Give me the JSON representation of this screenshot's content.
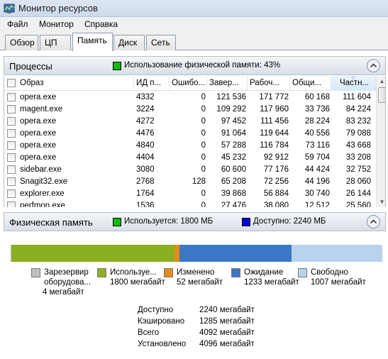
{
  "window": {
    "title": "Монитор ресурсов",
    "icon": "resource-monitor-icon"
  },
  "menu": [
    "Файл",
    "Монитор",
    "Справка"
  ],
  "tabs": [
    {
      "label": "Обзор",
      "active": false
    },
    {
      "label": "ЦП",
      "active": false
    },
    {
      "label": "Память",
      "active": true
    },
    {
      "label": "Диск",
      "active": false
    },
    {
      "label": "Сеть",
      "active": false
    }
  ],
  "processes": {
    "title": "Процессы",
    "indicator": "Использование физической памяти: 43%",
    "indicator_color": "#00c000",
    "columns": [
      "Образ",
      "ИД п...",
      "Ошибо...",
      "Завер...",
      "Рабоч...",
      "Общи...",
      "Частн..."
    ],
    "sorted_column": "Частн...",
    "rows": [
      [
        "opera.exe",
        "4332",
        "0",
        "121 536",
        "171 772",
        "60 168",
        "111 604"
      ],
      [
        "magent.exe",
        "3224",
        "0",
        "109 292",
        "117 960",
        "33 736",
        "84 224"
      ],
      [
        "opera.exe",
        "4272",
        "0",
        "97 452",
        "111 456",
        "28 224",
        "83 232"
      ],
      [
        "opera.exe",
        "4476",
        "0",
        "91 064",
        "119 644",
        "40 556",
        "79 088"
      ],
      [
        "opera.exe",
        "4840",
        "0",
        "57 288",
        "116 784",
        "73 116",
        "43 668"
      ],
      [
        "opera.exe",
        "4404",
        "0",
        "45 232",
        "92 912",
        "59 704",
        "33 208"
      ],
      [
        "sidebar.exe",
        "3080",
        "0",
        "60 600",
        "77 176",
        "44 424",
        "32 752"
      ],
      [
        "Snagit32.exe",
        "2768",
        "128",
        "65 208",
        "72 256",
        "44 196",
        "28 060"
      ],
      [
        "explorer.exe",
        "1764",
        "0",
        "39 868",
        "56 884",
        "30 740",
        "26 144"
      ],
      [
        "perfmon.exe",
        "1536",
        "0",
        "27 476",
        "38 080",
        "12 512",
        "25 560"
      ]
    ]
  },
  "physical_memory": {
    "title": "Физическая память",
    "in_use_text": "Используется: 1800 МБ",
    "in_use_color": "#00c000",
    "available_text": "Доступно: 2240 МБ",
    "available_color": "#0000d0",
    "bar_segments": [
      {
        "name": "Зарезервировано оборудованием",
        "mb": 4,
        "color": "#c0c0c0"
      },
      {
        "name": "Используется",
        "mb": 1800,
        "color": "#8cae23"
      },
      {
        "name": "Изменено",
        "mb": 52,
        "color": "#e88b12"
      },
      {
        "name": "Ожидание",
        "mb": 1233,
        "color": "#3a78c6"
      },
      {
        "name": "Свободно",
        "mb": 1007,
        "color": "#b9d3ef"
      }
    ],
    "legend": [
      {
        "label": "Зарезервир",
        "label2": "оборудова...",
        "value": "4 мегабайт",
        "color": "#c0c0c0"
      },
      {
        "label": "Используе...",
        "label2": "",
        "value": "1800 мегабайт",
        "color": "#8cae23"
      },
      {
        "label": "Изменено",
        "label2": "",
        "value": "52 мегабайт",
        "color": "#e88b12"
      },
      {
        "label": "Ожидание",
        "label2": "",
        "value": "1233 мегабайт",
        "color": "#3a78c6"
      },
      {
        "label": "Свободно",
        "label2": "",
        "value": "1007 мегабайт",
        "color": "#b9d3ef"
      }
    ],
    "stats": [
      {
        "label": "Доступно",
        "value": "2240 мегабайт"
      },
      {
        "label": "Кэшировано",
        "value": "1285 мегабайт"
      },
      {
        "label": "Всего",
        "value": "4092 мегабайт"
      },
      {
        "label": "Установлено",
        "value": "4096 мегабайт"
      }
    ]
  }
}
